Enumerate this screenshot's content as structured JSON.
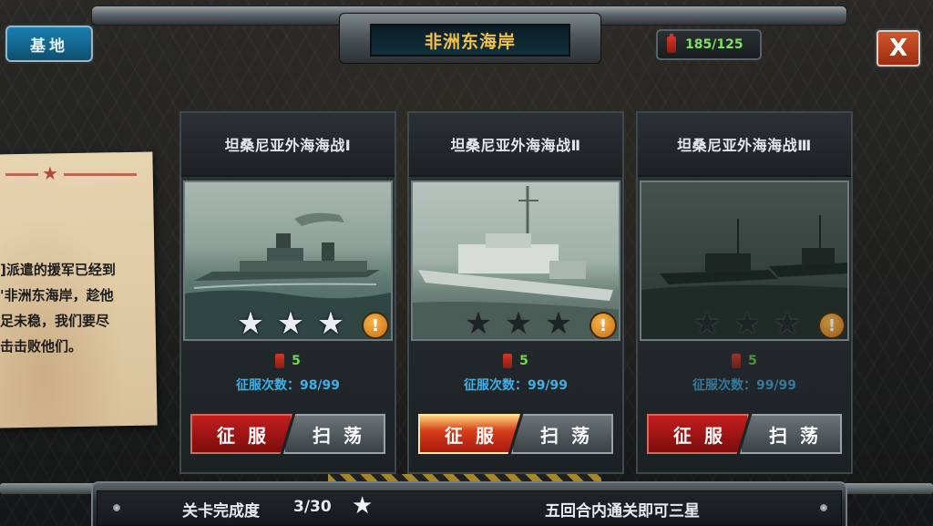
{
  "header": {
    "title": "非洲东海岸",
    "base_button": "基地",
    "fuel": "185/125",
    "close_label": "X"
  },
  "briefing": {
    "lines": [
      "]派遣的援军已经到",
      "'非洲东海岸，趁他",
      "足未稳，我们要尽",
      "击击败他们。"
    ]
  },
  "cards": [
    {
      "title": "坦桑尼亚外海海战Ⅰ",
      "stars_earned": 3,
      "cost": "5",
      "conquer_label": "征服次数：",
      "conquer_value": "98/99",
      "attack_label": "征服",
      "sweep_label": "扫荡"
    },
    {
      "title": "坦桑尼亚外海海战Ⅱ",
      "stars_earned": 0,
      "cost": "5",
      "conquer_label": "征服次数：",
      "conquer_value": "99/99",
      "attack_label": "征服",
      "sweep_label": "扫荡"
    },
    {
      "title": "坦桑尼亚外海海战Ⅲ",
      "stars_earned": 0,
      "cost": "5",
      "conquer_label": "征服次数：",
      "conquer_value": "99/99",
      "attack_label": "征服",
      "sweep_label": "扫荡"
    }
  ],
  "footer": {
    "progress_label": "关卡完成度",
    "progress_value": "3/30",
    "hint": "五回合内通关即可三星"
  },
  "colors": {
    "title_gold": "#f2c24a",
    "fuel_green": "#7fe061",
    "conquer_blue": "#3fb1e8",
    "attack_red": "#c21d1d"
  }
}
